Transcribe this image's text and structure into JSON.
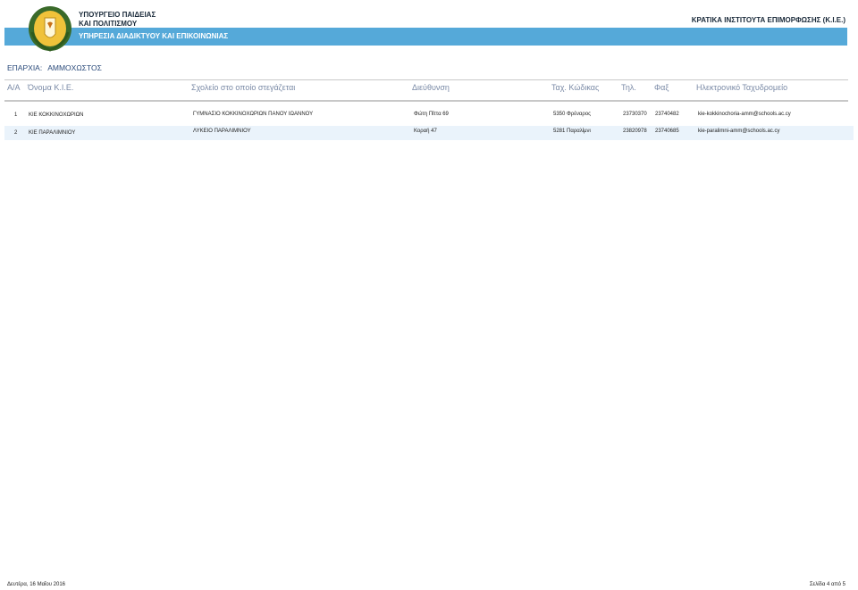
{
  "header": {
    "ministry_line1": "ΥΠΟΥΡΓΕΙΟ ΠΑΙΔΕΙΑΣ",
    "ministry_line2": "ΚΑΙ ΠΟΛΙΤΙΣΜΟΥ",
    "service": "ΥΠΗΡΕΣΙΑ ΔΙΑΔΙΚΤΥΟΥ ΚΑΙ ΕΠΙΚΟΙΝΩΝΙΑΣ",
    "institutes": "ΚΡΑΤΙΚΑ ΙΝΣΤΙΤΟΥΤΑ ΕΠΙΜΟΡΦΩΣΗΣ (Κ.Ι.Ε.)",
    "logo_icon": "cyprus-coat-of-arms-icon",
    "band_color": "#55a9d9"
  },
  "district": {
    "label": "ΕΠΑΡΧΙΑ:",
    "value": "ΑΜΜΟΧΩΣΤΟΣ"
  },
  "columns": {
    "aa": "Α/Α",
    "name": "Όνομα Κ.Ι.Ε.",
    "school": "Σχολείο στο οποίο στεγάζεται",
    "address": "Διεύθυνση",
    "postcode": "Ταχ. Κώδικας",
    "phone": "Τηλ.",
    "fax": "Φαξ",
    "email": "Ηλεκτρονικό Ταχυδρομείο"
  },
  "rows": [
    {
      "aa": "1",
      "name": "ΚΙΕ ΚΟΚΚΙΝΟΧΩΡΙΩΝ",
      "school": "ΓΥΜΝΑΣΙΟ ΚΟΚΚΙΝΟΧΩΡΙΩΝ ΠΑΝΟΥ ΙΩΑΝΝΟΥ",
      "address": "Φώτη Πίττα 69",
      "postcode": "5350 Φρέναρος",
      "phone": "23730370",
      "fax": "23740482",
      "email": "kie-kokkinochoria-amm@schools.ac.cy"
    },
    {
      "aa": "2",
      "name": "ΚΙΕ ΠΑΡΑΛΙΜΝΙΟΥ",
      "school": "ΛΥΚΕΙΟ ΠΑΡΑΛΙΜΝΙΟΥ",
      "address": "Κοραή 47",
      "postcode": "5281 Παραλίμνι",
      "phone": "23820978",
      "fax": "23740685",
      "email": "kie-paralimni-amm@schools.ac.cy"
    }
  ],
  "footer": {
    "date": "Δευτέρα, 16 Μαΐου 2016",
    "page": "Σελίδα 4 από 5"
  }
}
